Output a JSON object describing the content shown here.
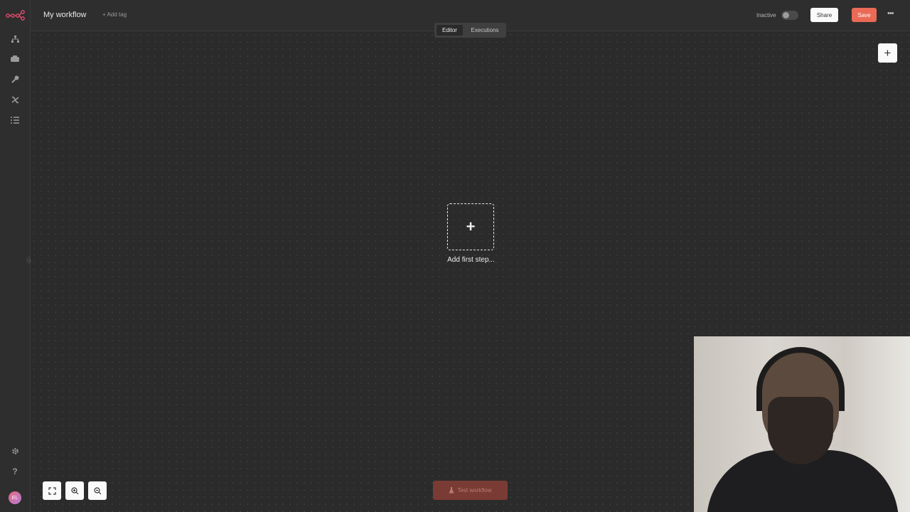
{
  "header": {
    "workflow_name": "My workflow",
    "add_tag": "+ Add tag",
    "status_label": "Inactive",
    "share_label": "Share",
    "save_label": "Save",
    "more_icon": "more-horizontal-icon"
  },
  "tabs": [
    {
      "label": "Editor",
      "active": true
    },
    {
      "label": "Executions",
      "active": false
    }
  ],
  "sidebar": {
    "items": [
      {
        "icon": "workflows-icon"
      },
      {
        "icon": "templates-icon"
      },
      {
        "icon": "credentials-icon"
      },
      {
        "icon": "variables-icon"
      },
      {
        "icon": "executions-list-icon"
      }
    ],
    "bottom": [
      {
        "icon": "settings-icon"
      },
      {
        "icon": "help-icon"
      }
    ],
    "avatar_initials": "EL"
  },
  "canvas": {
    "first_step_label": "Add first step...",
    "test_workflow_label": "Test workflow"
  },
  "colors": {
    "accent": "#ea6a55",
    "background": "#2b2b2b",
    "sidebar": "#2e2e2e"
  }
}
